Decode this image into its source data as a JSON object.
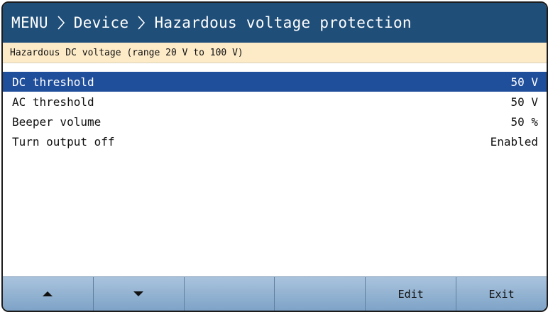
{
  "breadcrumb": {
    "items": [
      "MENU",
      "Device",
      "Hazardous voltage protection"
    ]
  },
  "info": {
    "text": "Hazardous DC voltage (range 20 V to 100 V)"
  },
  "settings": {
    "selected_index": 0,
    "items": [
      {
        "label": "DC threshold",
        "value": "50 V"
      },
      {
        "label": "AC threshold",
        "value": "50 V"
      },
      {
        "label": "Beeper volume",
        "value": "50 %"
      },
      {
        "label": "Turn output off",
        "value": "Enabled"
      }
    ]
  },
  "softkeys": {
    "up_icon": "triangle-up-icon",
    "down_icon": "triangle-down-icon",
    "key3": "",
    "key4": "",
    "edit": "Edit",
    "exit": "Exit"
  },
  "colors": {
    "title_bar": "#1f4e79",
    "info_bar": "#fdebc8",
    "selection": "#1f4e9b",
    "softkey_bar": "#8fb0d2"
  }
}
